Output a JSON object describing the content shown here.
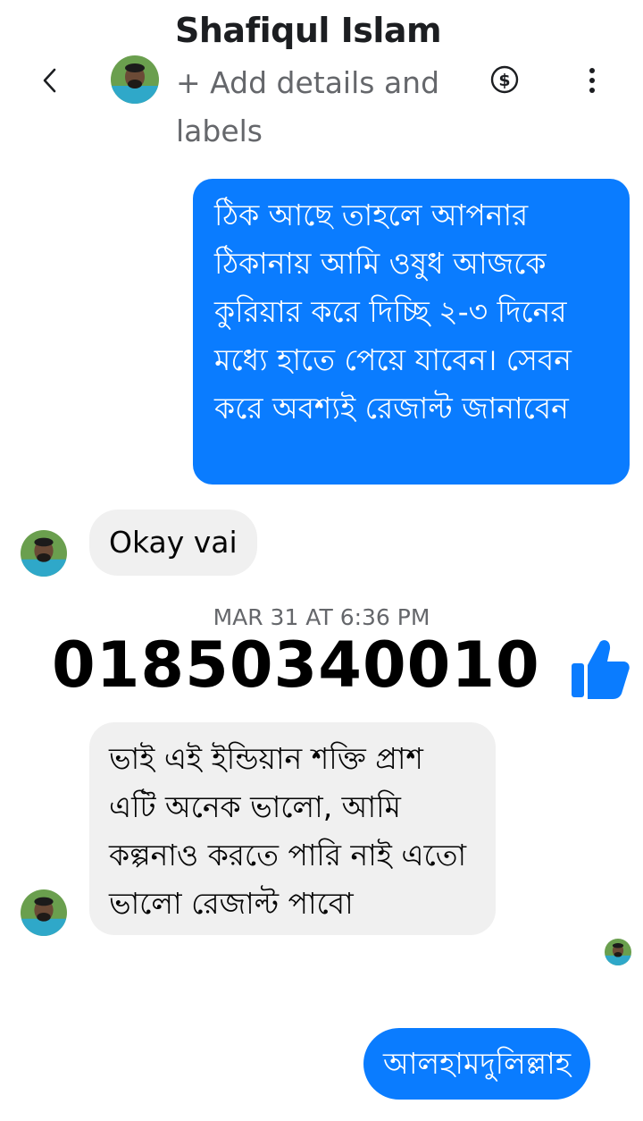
{
  "header": {
    "contact_name": "Shafiqul Islam",
    "subtitle": "+ Add details and labels",
    "icons": [
      "back-arrow-icon",
      "avatar",
      "dollar-icon",
      "more-options-icon"
    ]
  },
  "messages": [
    {
      "direction": "outgoing",
      "text": "ঠিক আছে তাহলে আপনার ঠিকানায় আমি ওষুধ আজকে কুরিয়ার করে দিচ্ছি ২-৩ দিনের মধ্যে হাতে পেয়ে যাবেন। সেবন করে অবশ্যই রেজাল্ট জানাবেন"
    },
    {
      "direction": "incoming",
      "text": "Okay vai"
    },
    {
      "direction": "incoming",
      "text": "ভাই এই ইন্ডিয়ান শক্তি প্রাশ এটি অনেক ভালো, আমি কল্পনাও করতে পারি নাই এতো ভালো রেজাল্ট পাবো"
    },
    {
      "direction": "outgoing",
      "text": "আলহামদুলিল্লাহ"
    }
  ],
  "timestamp": "MAR 31 AT 6:36 PM",
  "overlay_phone": "01850340010",
  "colors": {
    "accent": "#0a7cff",
    "incoming_bubble": "#f0f0f0",
    "secondary_text": "#65676b"
  }
}
